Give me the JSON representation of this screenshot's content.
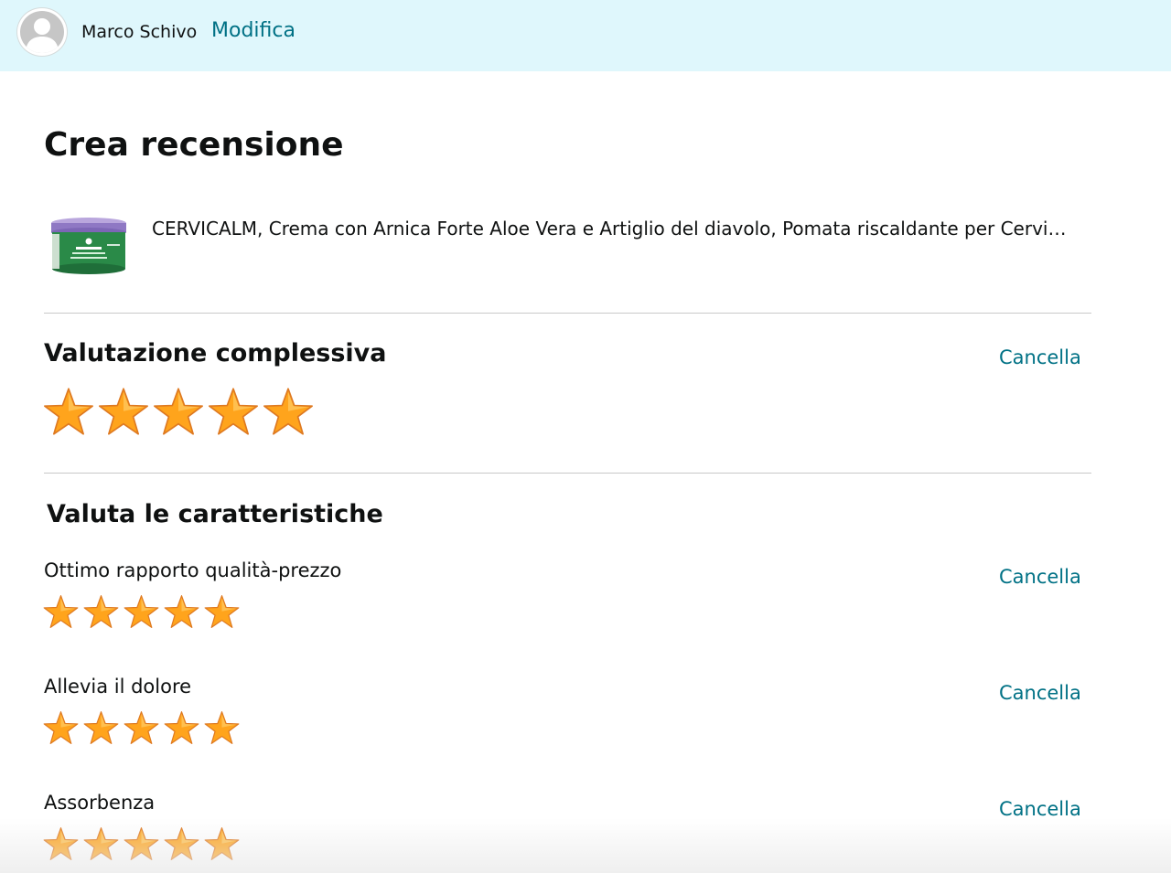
{
  "header": {
    "user_name": "Marco Schivo",
    "edit_label": "Modifica",
    "background": "#dff7fc"
  },
  "page_title": "Crea recensione",
  "product": {
    "title": "CERVICALM, Crema con Arnica Forte Aloe Vera e Artiglio del diavolo, Pomata riscaldante per Cervicale",
    "thumbnail_icon": "cream-jar-image",
    "jar_label": "CERVICALM"
  },
  "overall_rating": {
    "title": "Valutazione complessiva",
    "cancel_label": "Cancella",
    "rating": 5,
    "max": 5
  },
  "features": {
    "title": "Valuta le caratteristiche",
    "items": [
      {
        "label": "Ottimo rapporto qualità-prezzo",
        "cancel_label": "Cancella",
        "rating": 5,
        "max": 5
      },
      {
        "label": "Allevia il dolore",
        "cancel_label": "Cancella",
        "rating": 5,
        "max": 5
      },
      {
        "label": "Assorbenza",
        "cancel_label": "Cancella",
        "rating": 5,
        "max": 5
      }
    ]
  },
  "colors": {
    "link": "#007185",
    "star_fill": "#ffa41c",
    "divider": "#c8c8c8"
  }
}
